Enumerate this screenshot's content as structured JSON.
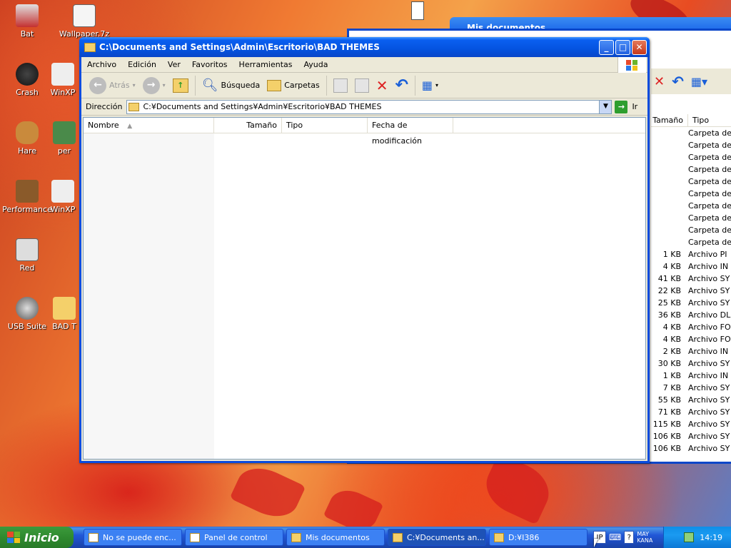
{
  "desktop": {
    "icons": [
      {
        "label": "Bat"
      },
      {
        "label": "Wallpaper.7z"
      },
      {
        "label": "Crash"
      },
      {
        "label": "WinXP"
      },
      {
        "label": "Hare"
      },
      {
        "label": "per"
      },
      {
        "label": "Performance"
      },
      {
        "label": "WinXP"
      },
      {
        "label": "Red"
      },
      {
        "label": "USB Suite"
      },
      {
        "label": "BAD T"
      }
    ]
  },
  "bg_window": {
    "title": "Mis documentos",
    "columns": {
      "size": "Tamaño",
      "type": "Tipo"
    },
    "rows": [
      {
        "size": "",
        "type": "Carpeta de"
      },
      {
        "size": "",
        "type": "Carpeta de"
      },
      {
        "size": "",
        "type": "Carpeta de"
      },
      {
        "size": "",
        "type": "Carpeta de"
      },
      {
        "size": "",
        "type": "Carpeta de"
      },
      {
        "size": "",
        "type": "Carpeta de"
      },
      {
        "size": "",
        "type": "Carpeta de"
      },
      {
        "size": "",
        "type": "Carpeta de"
      },
      {
        "size": "",
        "type": "Carpeta de"
      },
      {
        "size": "",
        "type": "Carpeta de"
      },
      {
        "size": "1 KB",
        "type": "Archivo PI"
      },
      {
        "size": "4 KB",
        "type": "Archivo IN"
      },
      {
        "size": "41 KB",
        "type": "Archivo SY"
      },
      {
        "size": "22 KB",
        "type": "Archivo SY"
      },
      {
        "size": "25 KB",
        "type": "Archivo SY"
      },
      {
        "size": "36 KB",
        "type": "Archivo DL"
      },
      {
        "size": "4 KB",
        "type": "Archivo FO"
      },
      {
        "size": "4 KB",
        "type": "Archivo FO"
      },
      {
        "size": "2 KB",
        "type": "Archivo IN"
      },
      {
        "size": "30 KB",
        "type": "Archivo SY"
      },
      {
        "size": "1 KB",
        "type": "Archivo IN"
      },
      {
        "size": "7 KB",
        "type": "Archivo SY"
      },
      {
        "size": "55 KB",
        "type": "Archivo SY"
      },
      {
        "size": "71 KB",
        "type": "Archivo SY"
      },
      {
        "size": "115 KB",
        "type": "Archivo SY"
      },
      {
        "size": "106 KB",
        "type": "Archivo SY"
      },
      {
        "size": "106 KB",
        "type": "Archivo SY"
      }
    ]
  },
  "window": {
    "title": "C:\\Documents and Settings\\Admin\\Escritorio\\BAD THEMES",
    "menu": [
      "Archivo",
      "Edición",
      "Ver",
      "Favoritos",
      "Herramientas",
      "Ayuda"
    ],
    "toolbar": {
      "back": "Atrás",
      "search": "Búsqueda",
      "folders": "Carpetas"
    },
    "address": {
      "label": "Dirección",
      "value": "C:¥Documents and Settings¥Admin¥Escritorio¥BAD THEMES",
      "go": "Ir"
    },
    "columns": {
      "name": "Nombre",
      "size": "Tamaño",
      "type": "Tipo",
      "modified": "Fecha de modificación"
    }
  },
  "taskbar": {
    "start": "Inicio",
    "tasks": [
      {
        "label": "No se puede enc..."
      },
      {
        "label": "Panel de control"
      },
      {
        "label": "Mis documentos"
      },
      {
        "label": "C:¥Documents an..."
      },
      {
        "label": "D:¥I386"
      }
    ],
    "ime": {
      "lang": "JP",
      "mode": "MAY",
      "kana": "KANA"
    },
    "clock": "14:19"
  },
  "colors": {
    "title_blue": "#0a5ff0",
    "taskbar_blue": "#2157d7",
    "start_green": "#2f8a2f"
  }
}
